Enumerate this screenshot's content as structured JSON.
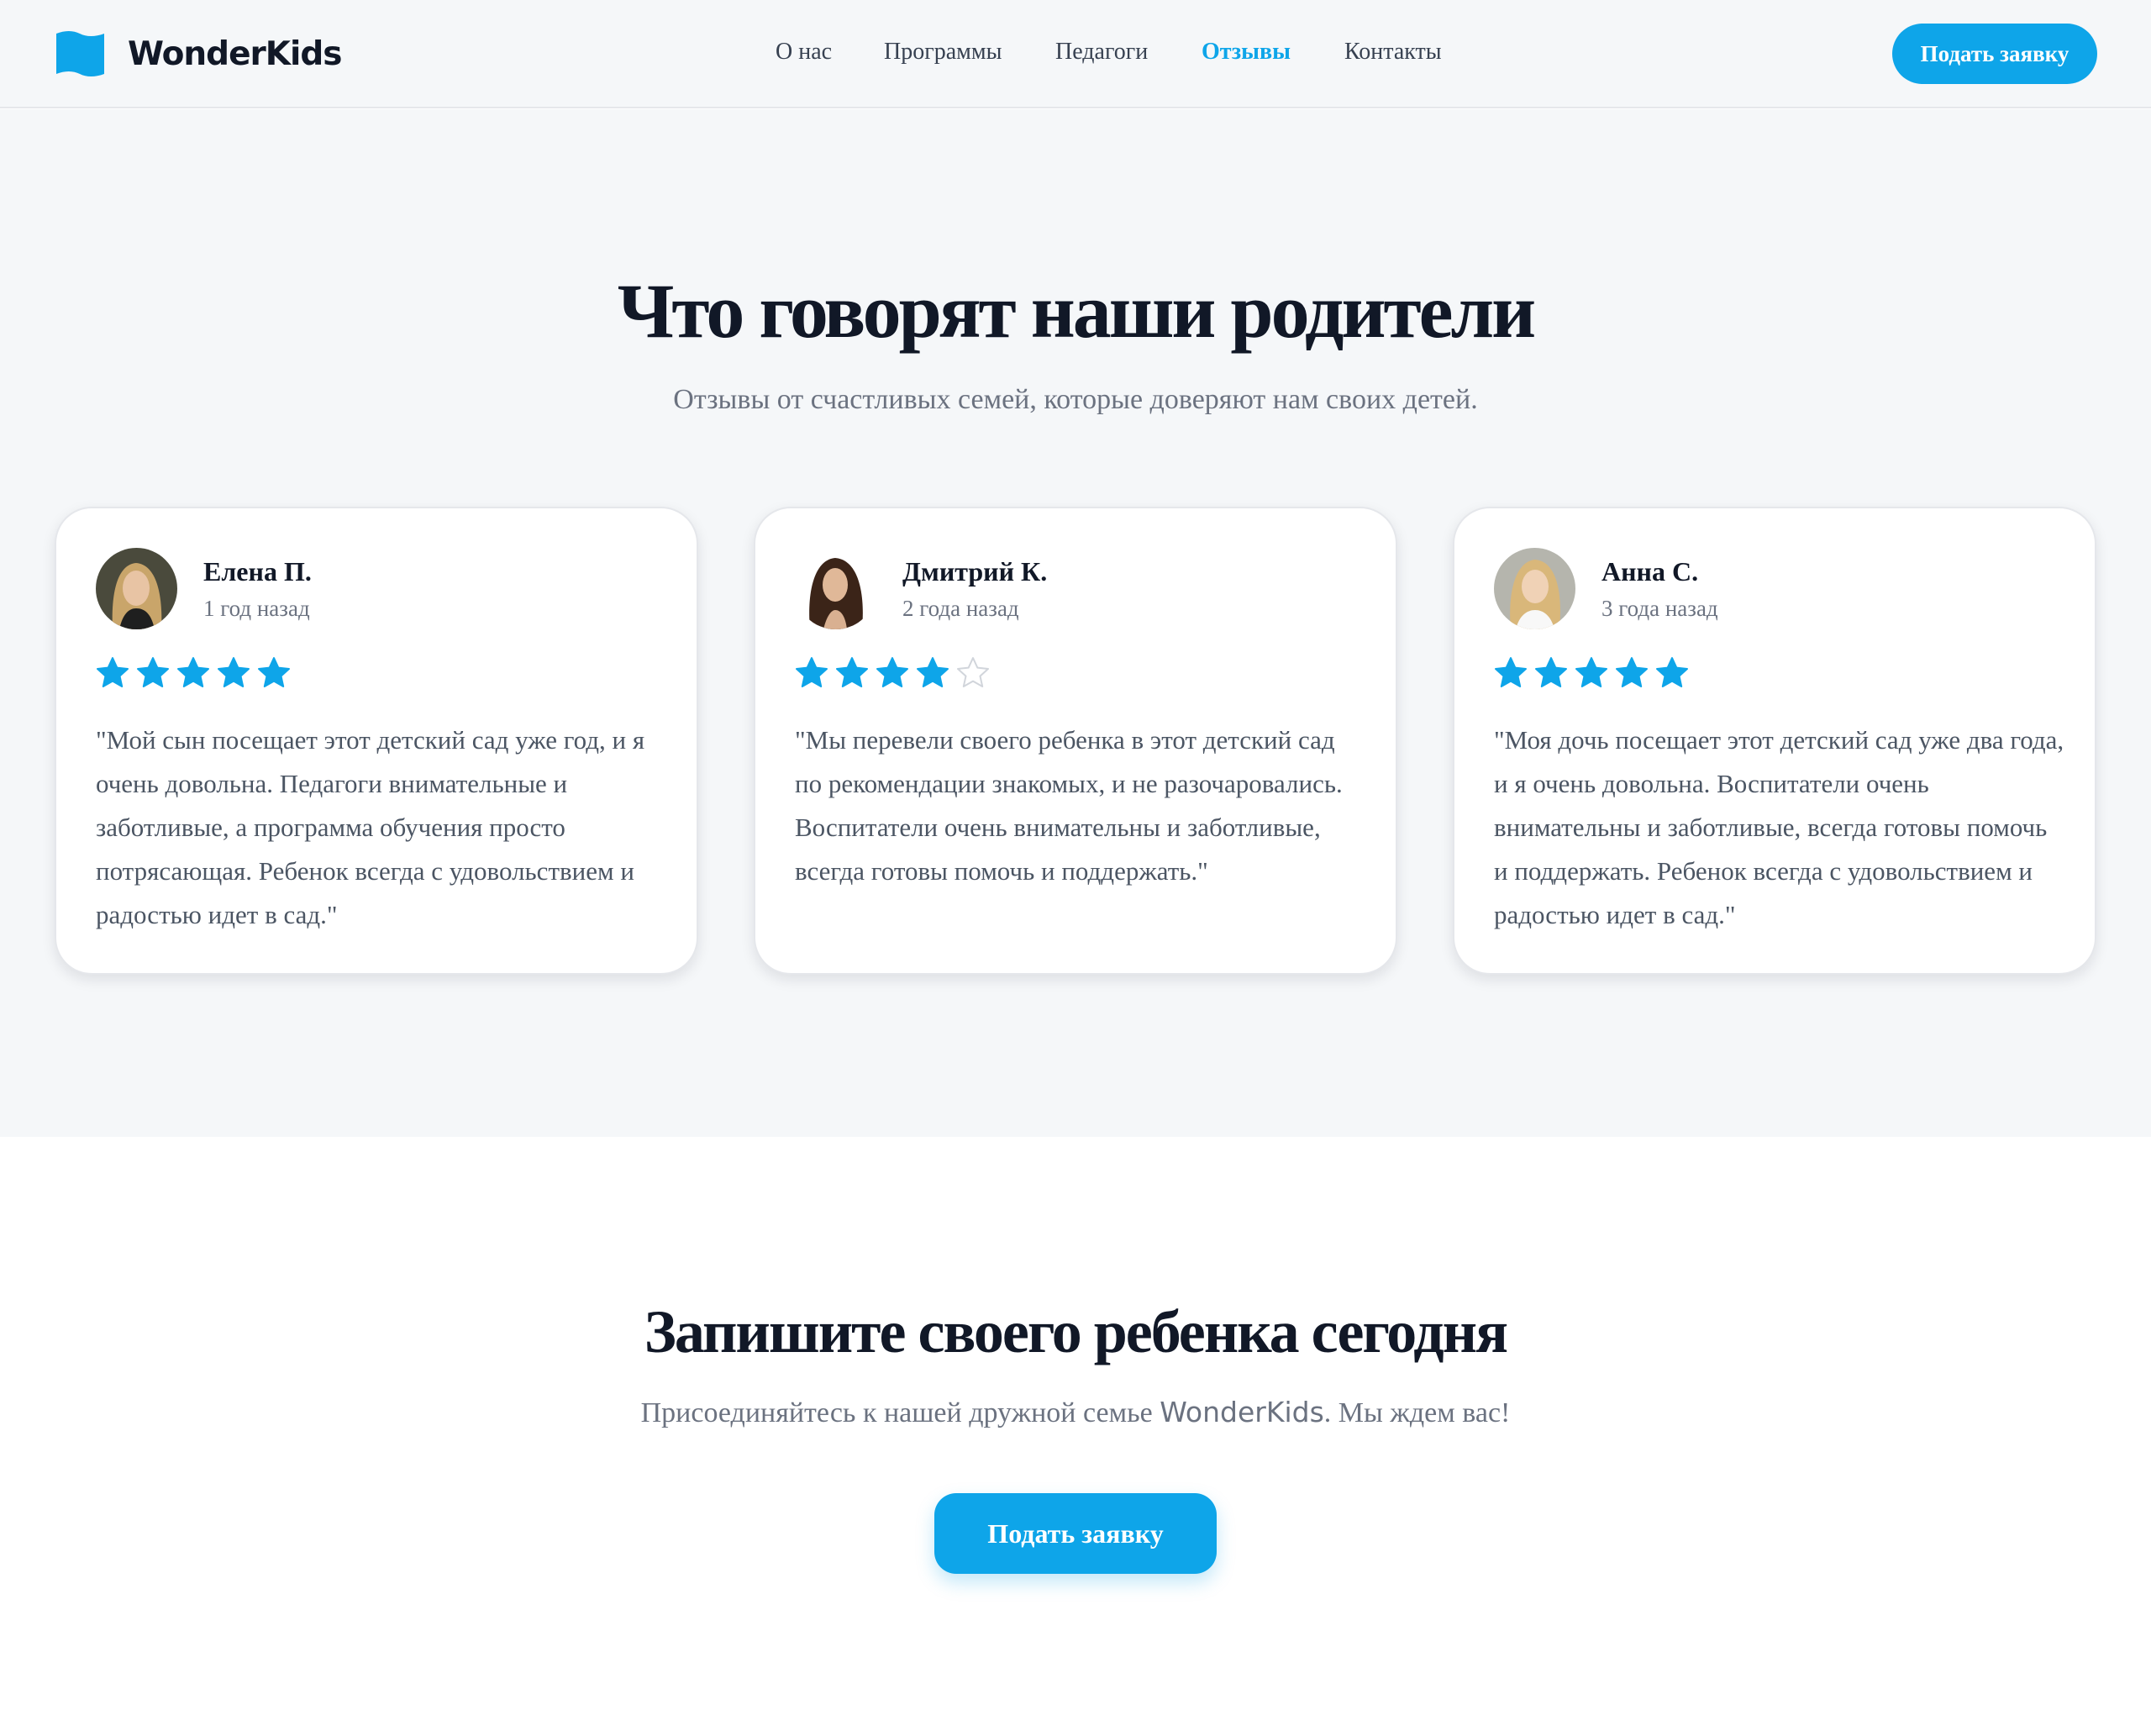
{
  "brand": {
    "name": "WonderKids",
    "logo_icon": "flag-icon",
    "accent_color": "#0ea5e9"
  },
  "nav": {
    "items": [
      {
        "label": "О нас",
        "active": false
      },
      {
        "label": "Программы",
        "active": false
      },
      {
        "label": "Педагоги",
        "active": false
      },
      {
        "label": "Отзывы",
        "active": true
      },
      {
        "label": "Контакты",
        "active": false
      }
    ],
    "cta_label": "Подать заявку"
  },
  "reviews": {
    "title": "Что говорят наши родители",
    "subtitle": "Отзывы от счастливых семей, которые доверяют нам своих детей.",
    "cards": [
      {
        "name": "Елена П.",
        "date": "1 год назад",
        "rating": 5,
        "max_rating": 5,
        "text": "\"Мой сын посещает этот детский сад уже год, и я очень довольна. Педагоги внимательные и заботливые, а программа обучения просто потрясающая. Ребенок всегда с удовольствием и радостью идет в сад.\""
      },
      {
        "name": "Дмитрий К.",
        "date": "2 года назад",
        "rating": 4,
        "max_rating": 5,
        "text": "\"Мы перевели своего ребенка в этот детский сад по рекомендации знакомых, и не разочаровались. Воспитатели очень внимательны и заботливые, всегда готовы помочь и поддержать.\""
      },
      {
        "name": "Анна С.",
        "date": "3 года назад",
        "rating": 5,
        "max_rating": 5,
        "text": "\"Моя дочь посещает этот детский сад уже два года, и я очень довольна. Воспитатели очень внимательны и заботливые, всегда готовы помочь и поддержать. Ребенок всегда с удовольствием и радостью идет в сад.\""
      }
    ]
  },
  "cta": {
    "title": "Запишите своего ребенка сегодня",
    "subtitle_before": "Присоединяйтесь к нашей дружной семье",
    "subtitle_brand": "WonderKids",
    "subtitle_after": ". Мы ждем вас!",
    "button_label": "Подать заявку"
  }
}
